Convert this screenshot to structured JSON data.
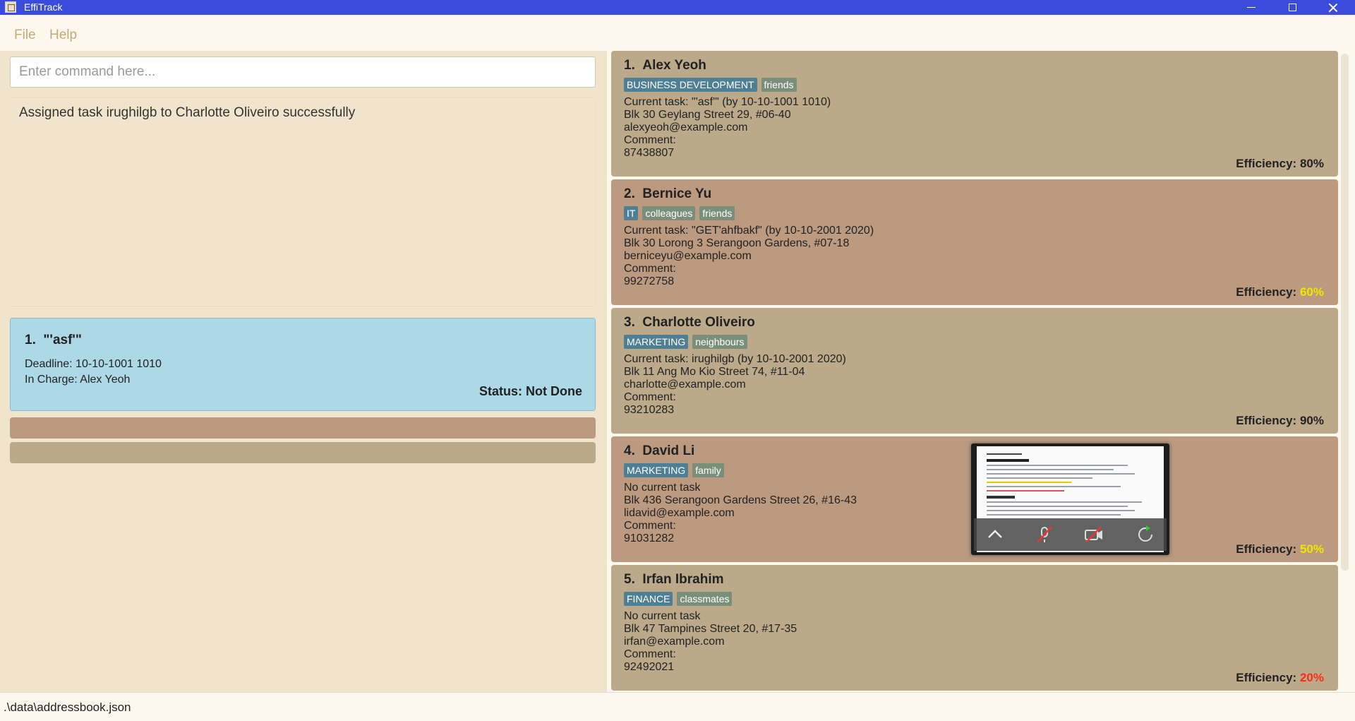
{
  "window": {
    "title": "EffiTrack"
  },
  "menu": {
    "file": "File",
    "help": "Help"
  },
  "command": {
    "placeholder": "Enter command here...",
    "value": ""
  },
  "result": {
    "message": "Assigned task irughilgb to Charlotte Oliveiro successfully"
  },
  "tasks": [
    {
      "index": "1.",
      "title": "\"'asf'\"",
      "deadline": "Deadline: 10-10-1001 1010",
      "in_charge": "In Charge: Alex Yeoh",
      "status": "Status: Not Done"
    }
  ],
  "persons": [
    {
      "index": "1.",
      "name": "Alex Yeoh",
      "tags": [
        "BUSINESS DEVELOPMENT",
        "friends"
      ],
      "task": "Current task: \"'asf'\" (by 10-10-1001 1010)",
      "address": "Blk 30 Geylang Street 29, #06-40",
      "email": "alexyeoh@example.com",
      "comment": "Comment:",
      "phone": "87438807",
      "eff_label": "Efficiency:",
      "eff_value": "80%",
      "eff_color": "#222222",
      "card_color": "#bca98a"
    },
    {
      "index": "2.",
      "name": "Bernice Yu",
      "tags": [
        "IT",
        "colleagues",
        "friends"
      ],
      "task": "Current task: \"GET'ahfbakf\" (by 10-10-2001 2020)",
      "address": "Blk 30 Lorong 3 Serangoon Gardens, #07-18",
      "email": "berniceyu@example.com",
      "comment": "Comment:",
      "phone": "99272758",
      "eff_label": "Efficiency:",
      "eff_value": "60%",
      "eff_color": "#f2e600",
      "card_color": "#bb9a80"
    },
    {
      "index": "3.",
      "name": "Charlotte Oliveiro",
      "tags": [
        "MARKETING",
        "neighbours"
      ],
      "task": "Current task: irughilgb (by 10-10-2001 2020)",
      "address": "Blk 11 Ang Mo Kio Street 74, #11-04",
      "email": "charlotte@example.com",
      "comment": "Comment:",
      "phone": "93210283",
      "eff_label": "Efficiency:",
      "eff_value": "90%",
      "eff_color": "#222222",
      "card_color": "#bca98a"
    },
    {
      "index": "4.",
      "name": "David Li",
      "tags": [
        "MARKETING",
        "family"
      ],
      "task": "No current task",
      "address": "Blk 436 Serangoon Gardens Street 26, #16-43",
      "email": "lidavid@example.com",
      "comment": "Comment:",
      "phone": "91031282",
      "eff_label": "Efficiency:",
      "eff_value": "50%",
      "eff_color": "#f2e600",
      "card_color": "#bb9a80"
    },
    {
      "index": "5.",
      "name": "Irfan Ibrahim",
      "tags": [
        "FINANCE",
        "classmates"
      ],
      "task": "No current task",
      "address": "Blk 47 Tampines Street 20, #17-35",
      "email": "irfan@example.com",
      "comment": "Comment:",
      "phone": "92492021",
      "eff_label": "Efficiency:",
      "eff_value": "20%",
      "eff_color": "#ff2a1a",
      "card_color": "#bca98a"
    }
  ],
  "status_bar": {
    "path": ".\\data\\addressbook.json"
  }
}
